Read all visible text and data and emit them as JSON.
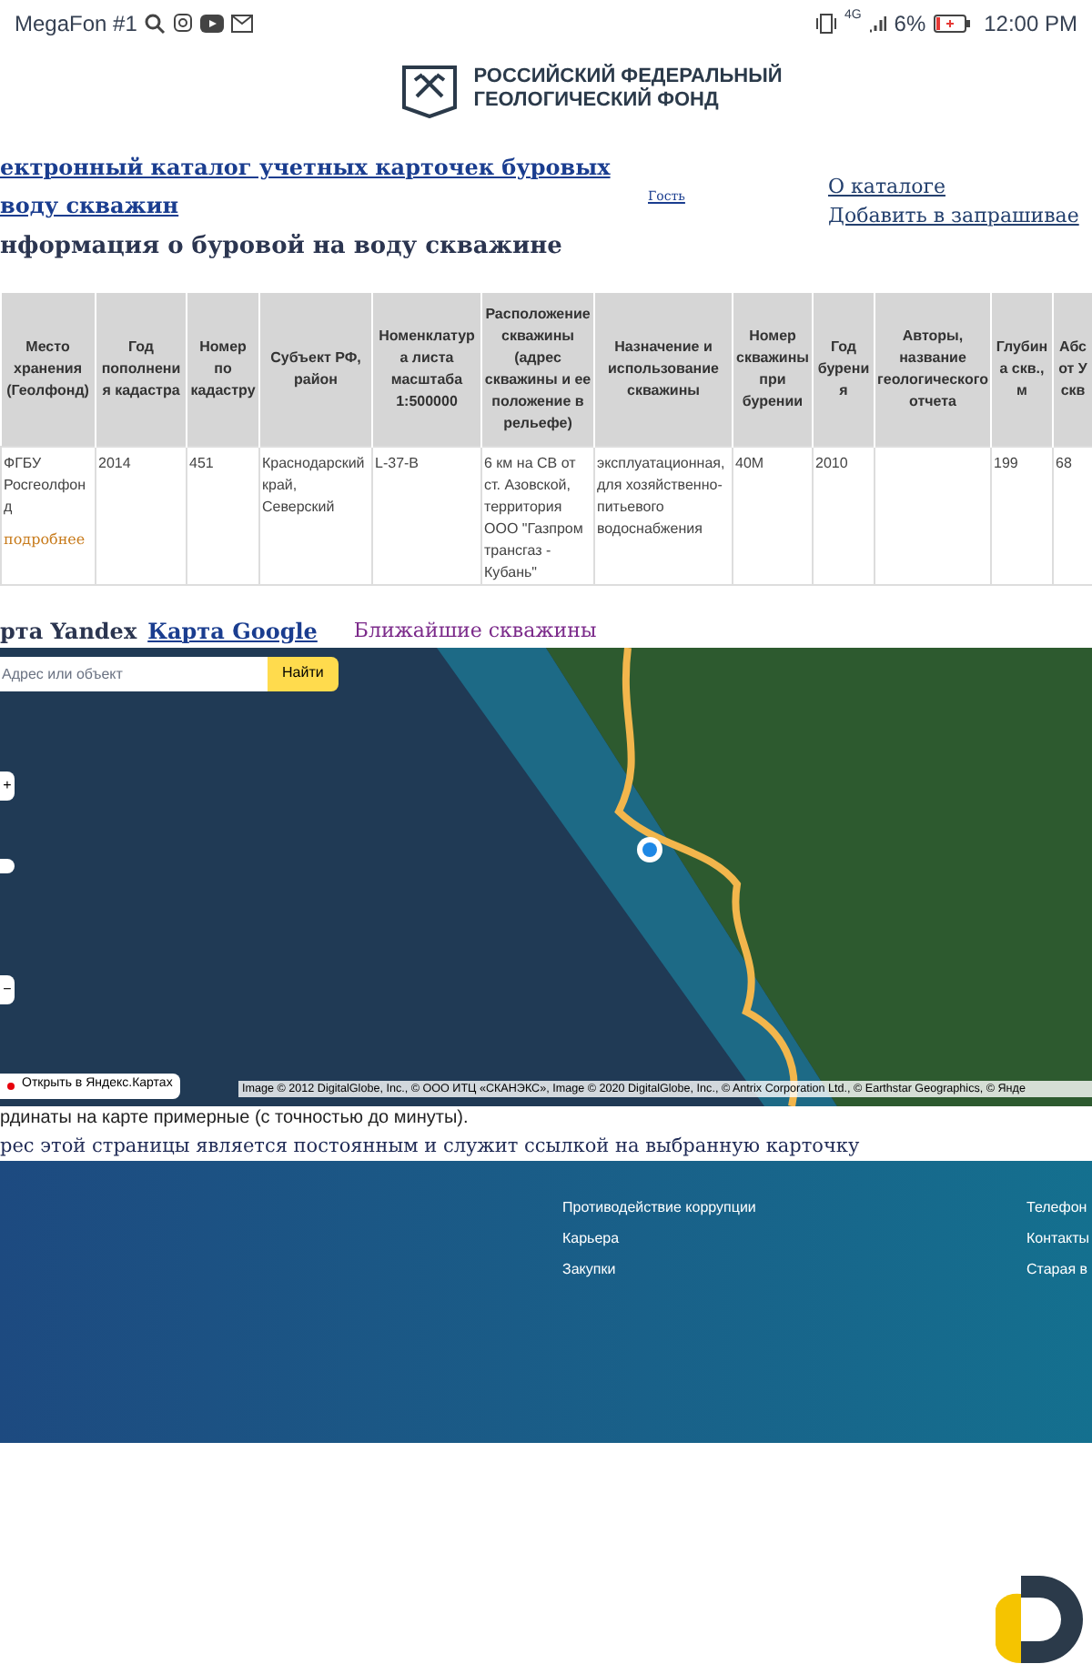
{
  "status_bar": {
    "carrier": "MegaFon #1",
    "battery": "6%",
    "time": "12:00 PM",
    "network": "4G"
  },
  "header": {
    "org_name_line1": "РОССИЙСКИЙ ФЕДЕРАЛЬНЫЙ",
    "org_name_line2": "ГЕОЛОГИЧЕСКИЙ ФОНД"
  },
  "catalog_title_lines": [
    "ектронный каталог учетных карточек буровых",
    "воду скважин"
  ],
  "user": "Гость",
  "nav_links": [
    "О каталоге",
    "Добавить в запрашивае"
  ],
  "page_heading": "нформация о буровой на воду скважине",
  "table": {
    "columns": [
      "Место хранения (Геолфонд)",
      "Год пополнения кадастра",
      "Номер по кадастру",
      "Субъект РФ, район",
      "Номенклатура листа масштаба 1:500000",
      "Расположение скважины (адрес скважины и ее положение в рельефе)",
      "Назначение и использование скважины",
      "Номер скважины при бурении",
      "Год бурения",
      "Авторы, название геологического отчета",
      "Глубина скв., м",
      "Абс от У скв"
    ],
    "rows": [
      {
        "cells": [
          "ФГБУ Росгеолфонд",
          "2014",
          "451",
          "Краснодарский край, Северский",
          "L-37-В",
          "6 км на СВ от ст. Азовской, территория ООО \"Газпром трансгаз - Кубань\"",
          "эксплуатационная, для хозяйственно-питьевого водоснабжения",
          "40М",
          "2010",
          "",
          "199",
          "68"
        ],
        "more_link": "подробнее"
      }
    ]
  },
  "map_tabs": [
    {
      "label": "рта Yandex",
      "selected": true
    },
    {
      "label": "Карта Google",
      "selected": false
    }
  ],
  "nearby_link": "Ближайшие скважины",
  "map": {
    "search_placeholder": "Адрес или объект",
    "search_button": "Найти",
    "zoom_in": "+",
    "zoom_out": "−",
    "open_link": "Открыть в Яндекс.Картах",
    "copyright": "Image © 2012 DigitalGlobe, Inc., © ООО ИТЦ «СКАНЭКС», Image © 2020 DigitalGlobe, Inc., © Antrix Corporation Ltd., © Earthstar Geographics, © Янде"
  },
  "notes": [
    "рдинаты на карте примерные (с точностью до минуты).",
    "рес этой страницы является постоянным и служит ссылкой на выбранную карточку"
  ],
  "footer": {
    "column_1": [
      "Противодействие коррупции",
      "Карьера",
      "Закупки"
    ],
    "column_2": [
      "Телефон",
      "Контакты",
      "Старая в"
    ]
  }
}
